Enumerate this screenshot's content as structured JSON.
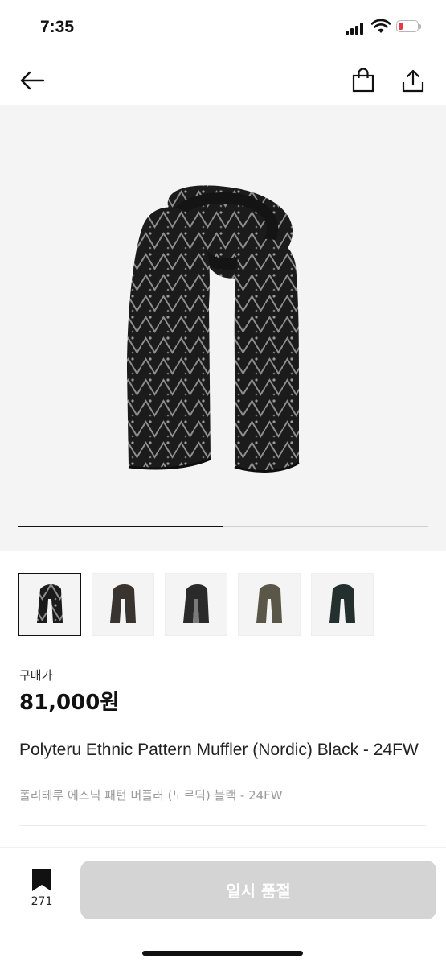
{
  "status_bar": {
    "time": "7:35"
  },
  "nav": {
    "back_icon": "arrow-left-icon",
    "bag_icon": "shopping-bag-icon",
    "share_icon": "share-icon"
  },
  "gallery": {
    "image_count": 5,
    "current_index": 1,
    "progress_fraction": 0.5,
    "thumbnails": [
      {
        "alt": "scarf thumbnail 1",
        "active": true
      },
      {
        "alt": "scarf thumbnail 2",
        "active": false
      },
      {
        "alt": "scarf thumbnail 3",
        "active": false
      },
      {
        "alt": "scarf thumbnail 4",
        "active": false
      },
      {
        "alt": "scarf thumbnail 5",
        "active": false
      }
    ]
  },
  "product": {
    "price_label": "구매가",
    "price": "81,000원",
    "title": "Polyteru Ethnic Pattern Muffler (Nordic) Black - 24FW",
    "subtitle": "폴리테루 에스닉 패턴 머플러 (노르딕) 블랙 - 24FW"
  },
  "bottom_bar": {
    "wish_icon": "bookmark-icon",
    "wish_count": "271",
    "cta_label": "일시 품절"
  },
  "colors": {
    "accent": "#111111",
    "cta_disabled": "#d4d4d4",
    "hero_bg": "#f4f4f4",
    "battery_low": "#e63946"
  }
}
